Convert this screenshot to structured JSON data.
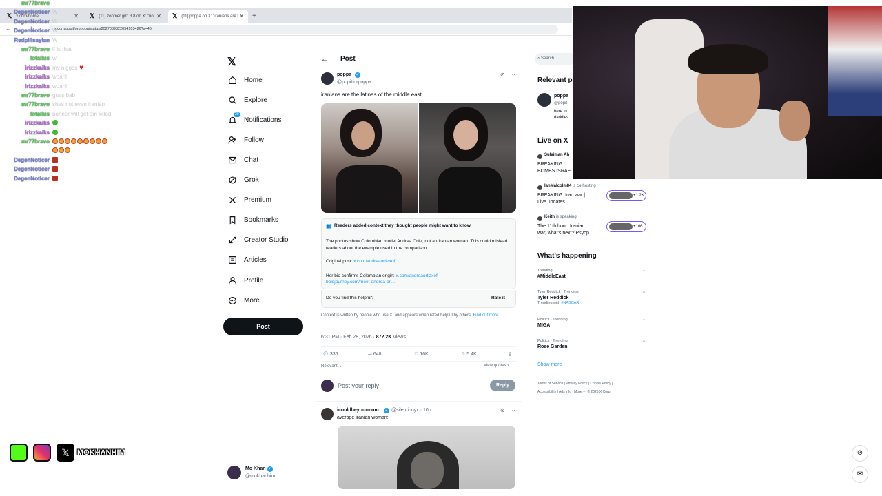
{
  "browser": {
    "tabs": [
      {
        "title": "x.com/home"
      },
      {
        "title": "(11) zoomer girl: 3.8 on X: \"no…"
      },
      {
        "title": "(11) poppa on X: \"iranians are t…"
      }
    ],
    "new_tab": "+",
    "url": "x.com/popitforpoppa/status/2027889322054103426?s=46"
  },
  "chat": [
    {
      "name": "mr77bravo",
      "color": "#5cd35c",
      "msg": "",
      "emotes": 0
    },
    {
      "name": "DegenNoticer",
      "color": "#7b86e8",
      "msg": "W",
      "emotes": 0
    },
    {
      "name": "DegenNoticer",
      "color": "#7b86e8",
      "msg": "W",
      "emotes": 0
    },
    {
      "name": "DegenNoticer",
      "color": "#7b86e8",
      "msg": "W",
      "emotes": 0
    },
    {
      "name": "Redpillsaylan",
      "color": "#7b86e8",
      "msg": "W",
      "emotes": 0
    },
    {
      "name": "mr77bravo",
      "color": "#5cd35c",
      "msg": "if is that",
      "emotes": 0
    },
    {
      "name": "lotalius",
      "color": "#5cd35c",
      "msg": "w",
      "emotes": 0
    },
    {
      "name": "irizzkaiks",
      "color": "#c36ae8",
      "msg": "my niggas",
      "emotes": 0,
      "heart": true
    },
    {
      "name": "irizzkaiks",
      "color": "#c36ae8",
      "msg": "woahl",
      "emotes": 0
    },
    {
      "name": "irizzkaiks",
      "color": "#c36ae8",
      "msg": "woahl",
      "emotes": 0
    },
    {
      "name": "mr77bravo",
      "color": "#5cd35c",
      "msg": "gues bab",
      "emotes": 0
    },
    {
      "name": "mr77bravo",
      "color": "#5cd35c",
      "msg": "shes not even iranian",
      "emotes": 0
    },
    {
      "name": "lotalius",
      "color": "#5cd35c",
      "msg": "ponner will get em killed",
      "emotes": 0
    },
    {
      "name": "irizzkaiks",
      "color": "#c36ae8",
      "msg": "",
      "emotes": 1,
      "kind": "grn"
    },
    {
      "name": "irizzkaiks",
      "color": "#c36ae8",
      "msg": "",
      "emotes": 1,
      "kind": "grn"
    },
    {
      "name": "mr77bravo",
      "color": "#5cd35c",
      "msg": "",
      "emotes": 9,
      "kind": "face"
    },
    {
      "name": "",
      "color": "#5cd35c",
      "msg": "",
      "emotes": 3,
      "kind": "face"
    },
    {
      "name": "DegenNoticer",
      "color": "#7b86e8",
      "msg": "",
      "emotes": 1,
      "kind": "red"
    },
    {
      "name": "DegenNoticer",
      "color": "#7b86e8",
      "msg": "",
      "emotes": 1,
      "kind": "red"
    },
    {
      "name": "DegenNoticer",
      "color": "#7b86e8",
      "msg": "",
      "emotes": 1,
      "kind": "red"
    }
  ],
  "nav": {
    "items": [
      {
        "label": "Home",
        "icon": "home-icon"
      },
      {
        "label": "Explore",
        "icon": "search-icon"
      },
      {
        "label": "Notifications",
        "icon": "bell-icon",
        "badge": "20"
      },
      {
        "label": "Follow",
        "icon": "follow-icon"
      },
      {
        "label": "Chat",
        "icon": "mail-icon"
      },
      {
        "label": "Grok",
        "icon": "grok-icon"
      },
      {
        "label": "Premium",
        "icon": "x-premium-icon"
      },
      {
        "label": "Bookmarks",
        "icon": "bookmark-icon"
      },
      {
        "label": "Creator Studio",
        "icon": "creator-studio-icon"
      },
      {
        "label": "Articles",
        "icon": "articles-icon"
      },
      {
        "label": "Profile",
        "icon": "person-icon"
      },
      {
        "label": "More",
        "icon": "more-circle-icon"
      }
    ],
    "post_label": "Post",
    "account": {
      "name": "Mo Khan",
      "handle": "@mokhanhim"
    }
  },
  "post": {
    "header": "Post",
    "author": {
      "name": "poppa",
      "handle": "@popitforpoppa"
    },
    "text": "iranians are the latinas of the middle east",
    "note": {
      "title": "Readers added context they thought people might want to know",
      "body": "The photos show Colombian model Andrea Ortiz, not an Iranian woman. This could mislead readers about the example used in the comparison.",
      "orig_label": "Original post: ",
      "orig_link": "x.com/andreaortizxof…",
      "bio_label": "Her bio confirms Colombian origin: ",
      "bio_link1": "x.com/andreaortizxof",
      "bio_link2": "boldjourney.com/meet-andrea-or…",
      "helpful": "Do you find this helpful?",
      "rate": "Rate it",
      "footer": "Context is written by people who use X, and appears when rated helpful by others.",
      "footer_link": "Find out more."
    },
    "time": "6:31 PM · Feb 28, 2026 · ",
    "views": "872.2K",
    "views_label": " Views",
    "stats": {
      "replies": "336",
      "reposts": "648",
      "likes": "16K",
      "bookmarks": "5.4K"
    },
    "relevant": "Relevant",
    "view_quotes": "View quotes",
    "reply_placeholder": "Post your reply",
    "reply_btn": "Reply"
  },
  "reply": {
    "name": "icouldbeyourmom",
    "handle": "@silentionyx · 10h",
    "text": "average iranian woman:"
  },
  "right": {
    "search": "Search",
    "relevant_title": "Relevant p",
    "relevant_name": "poppa",
    "relevant_handle": "@popit",
    "relevant_bio1": "here to",
    "relevant_bio2": "daddies",
    "live_title": "Live on X",
    "live": [
      {
        "host": "Sulaiman Ah",
        "status": "",
        "title1": "BREAKING:",
        "title2": "BOMBS ISRAE",
        "count": ""
      },
      {
        "host": "IanMalcolm84",
        "status": "is co-hosting",
        "title1": "BREAKING: Iran war |",
        "title2": "Live updates",
        "count": "+1.2K"
      },
      {
        "host": "Keith",
        "status": "is speaking",
        "title1": "The 11th hour: Iranian",
        "title2": "war, what's next? Psyop…",
        "count": "+106"
      }
    ],
    "happening_title": "What's happening",
    "trends": [
      {
        "meta": "Trending",
        "name": "#MiddleEast",
        "extra": "",
        "extra_link": ""
      },
      {
        "meta": "Tyler Reddick · Trending",
        "name": "Tyler Reddick",
        "extra": "Trending with ",
        "extra_link": "#NASCAR"
      },
      {
        "meta": "Politics · Trending",
        "name": "MIGA",
        "extra": "",
        "extra_link": ""
      },
      {
        "meta": "Politics · Trending",
        "name": "Rose Garden",
        "extra": "",
        "extra_link": ""
      }
    ],
    "show_more": "Show more",
    "footer1": "Terms of Service  |  Privacy Policy  |  Cookie Policy  |",
    "footer2": "Accessibility  |  Ads info  |  More ···  © 2026 X Corp."
  },
  "overlay": {
    "social_handle": "MOKHANHIM"
  },
  "colors": {
    "accent": "#1d9bf0",
    "text": "#0f1419",
    "muted": "#536471"
  }
}
